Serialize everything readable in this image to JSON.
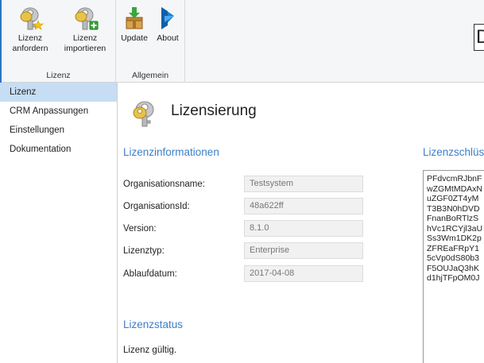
{
  "ribbon": {
    "buttons": {
      "anfordern": [
        "Lizenz",
        "anfordern"
      ],
      "importieren": [
        "Lizenz",
        "importieren"
      ],
      "update": "Update",
      "about": "About"
    },
    "groups": {
      "lizenz": "Lizenz",
      "allgemein": "Allgemein"
    },
    "title_fragment": "D"
  },
  "sidebar": {
    "items": [
      {
        "label": "Lizenz",
        "active": true
      },
      {
        "label": "CRM Anpassungen"
      },
      {
        "label": "Einstellungen"
      },
      {
        "label": "Dokumentation"
      }
    ]
  },
  "main": {
    "title": "Lizensierung",
    "info_section": "Lizenzinformationen",
    "key_section": "Lizenzschlüs",
    "fields": {
      "organisationsname": {
        "label": "Organisationsname:",
        "value": "Testsystem"
      },
      "organisationsid": {
        "label": "OrganisationsId:",
        "value": "48a622ff"
      },
      "version": {
        "label": "Version:",
        "value": "8.1.0"
      },
      "lizenztyp": {
        "label": "Lizenztyp:",
        "value": "Enterprise"
      },
      "ablaufdatum": {
        "label": "Ablaufdatum:",
        "value": "2017-04-08"
      }
    },
    "key_lines": [
      "PFdvcmRJbnF",
      "wZGMtMDAxN",
      "uZGF0ZT4yM",
      "T3B3N0hDVD",
      "FnanBoRTlzS",
      "hVc1RCYjl3aU",
      "Ss3Wm1DK2p",
      "ZFREaFRpY1",
      "5cVp0dS80b3",
      "F5OUJaQ3hK",
      "d1hjTFpOM0J"
    ],
    "status_section": "Lizenzstatus",
    "status_text": "Lizenz gültig."
  },
  "colors": {
    "accent": "#3c7fc8",
    "selection": "#c6ddf4",
    "window_border": "#2b74c7"
  },
  "icons": {
    "anfordern": "key-star-icon",
    "importieren": "key-plus-icon",
    "update": "package-download-icon",
    "about": "dynamics-logo-icon",
    "page": "keys-icon"
  }
}
